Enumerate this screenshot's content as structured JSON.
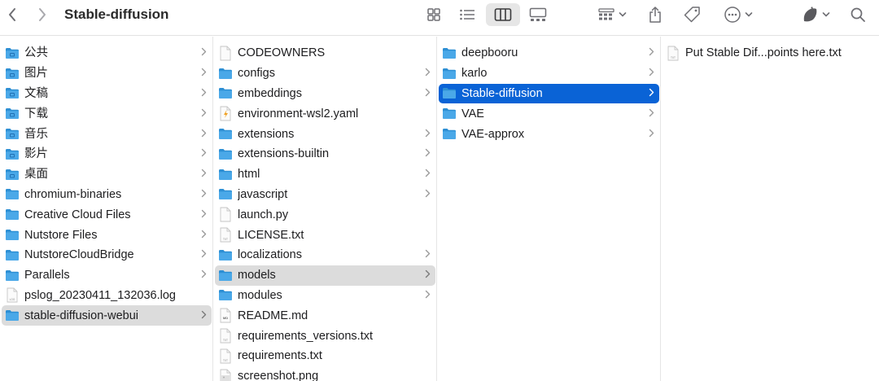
{
  "window": {
    "title": "Stable-diffusion"
  },
  "colors": {
    "folder": "#4aa8e8",
    "folder_dark": "#2d8fd4",
    "selection_blue": "#0a63d6",
    "selection_gray": "#dcdcdc"
  },
  "toolbar": {
    "back_icon": "chevron-left-icon",
    "forward_icon": "chevron-right-icon",
    "view_icons": [
      "icon-view-icon",
      "list-view-icon",
      "column-view-icon",
      "gallery-view-icon"
    ],
    "active_view": "column-view-icon",
    "group_icon": "group-icon",
    "share_icon": "share-icon",
    "tag_icon": "tag-icon",
    "more_icon": "ellipsis-icon",
    "extension_icon": "extension-icon",
    "search_icon": "search-icon"
  },
  "columns": [
    {
      "items": [
        {
          "name": "公共",
          "kind": "folder-special",
          "chevron": true
        },
        {
          "name": "图片",
          "kind": "folder-special",
          "chevron": true
        },
        {
          "name": "文稿",
          "kind": "folder-special",
          "chevron": true
        },
        {
          "name": "下载",
          "kind": "folder-special",
          "chevron": true
        },
        {
          "name": "音乐",
          "kind": "folder-special",
          "chevron": true
        },
        {
          "name": "影片",
          "kind": "folder-special",
          "chevron": true
        },
        {
          "name": "桌面",
          "kind": "folder-special",
          "chevron": true
        },
        {
          "name": "chromium-binaries",
          "kind": "folder",
          "chevron": true
        },
        {
          "name": "Creative Cloud Files",
          "kind": "folder",
          "chevron": true
        },
        {
          "name": "Nutstore Files",
          "kind": "folder",
          "chevron": true
        },
        {
          "name": "NutstoreCloudBridge",
          "kind": "folder",
          "chevron": true
        },
        {
          "name": "Parallels",
          "kind": "folder",
          "chevron": true
        },
        {
          "name": "pslog_20230411_132036.log",
          "kind": "log",
          "chevron": false
        },
        {
          "name": "stable-diffusion-webui",
          "kind": "folder",
          "chevron": true,
          "selected": "gray"
        }
      ]
    },
    {
      "items": [
        {
          "name": "CODEOWNERS",
          "kind": "doc",
          "chevron": false
        },
        {
          "name": "configs",
          "kind": "folder",
          "chevron": true
        },
        {
          "name": "embeddings",
          "kind": "folder",
          "chevron": true
        },
        {
          "name": "environment-wsl2.yaml",
          "kind": "yaml",
          "chevron": false
        },
        {
          "name": "extensions",
          "kind": "folder",
          "chevron": true
        },
        {
          "name": "extensions-builtin",
          "kind": "folder",
          "chevron": true
        },
        {
          "name": "html",
          "kind": "folder",
          "chevron": true
        },
        {
          "name": "javascript",
          "kind": "folder",
          "chevron": true
        },
        {
          "name": "launch.py",
          "kind": "doc",
          "chevron": false
        },
        {
          "name": "LICENSE.txt",
          "kind": "txt",
          "chevron": false
        },
        {
          "name": "localizations",
          "kind": "folder",
          "chevron": true
        },
        {
          "name": "models",
          "kind": "folder",
          "chevron": true,
          "selected": "gray"
        },
        {
          "name": "modules",
          "kind": "folder",
          "chevron": true
        },
        {
          "name": "README.md",
          "kind": "md",
          "chevron": false
        },
        {
          "name": "requirements_versions.txt",
          "kind": "txt",
          "chevron": false
        },
        {
          "name": "requirements.txt",
          "kind": "txt",
          "chevron": false
        },
        {
          "name": "screenshot.png",
          "kind": "image",
          "chevron": false
        }
      ]
    },
    {
      "items": [
        {
          "name": "deepbooru",
          "kind": "folder",
          "chevron": true
        },
        {
          "name": "karlo",
          "kind": "folder",
          "chevron": true
        },
        {
          "name": "Stable-diffusion",
          "kind": "folder",
          "chevron": true,
          "selected": "blue"
        },
        {
          "name": "VAE",
          "kind": "folder",
          "chevron": true
        },
        {
          "name": "VAE-approx",
          "kind": "folder",
          "chevron": true
        }
      ]
    },
    {
      "items": [
        {
          "name": "Put Stable Dif...points here.txt",
          "kind": "txt",
          "chevron": false
        }
      ]
    }
  ]
}
